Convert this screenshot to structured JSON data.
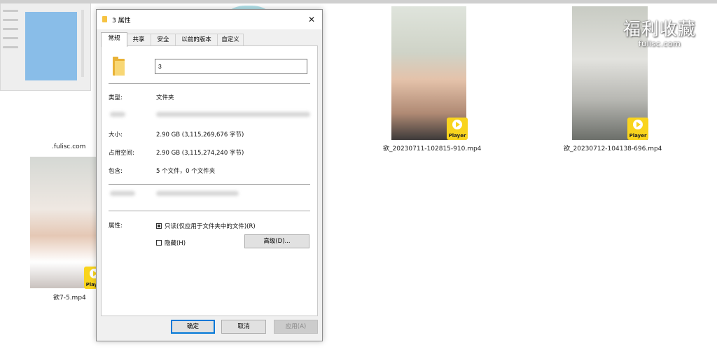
{
  "desktop": {
    "web_item_label": ".fulisc.com",
    "video_items": [
      {
        "label": "欲7-5.mp4"
      },
      {
        "label": "欲_20230711-102815-910.mp4"
      },
      {
        "label": "欲_20230712-104138-696.mp4"
      }
    ],
    "player_badge": "Player",
    "watermark": {
      "line1": "福利收藏",
      "line2": "fulisc.com"
    }
  },
  "dialog": {
    "title": "3 属性",
    "close_glyph": "✕",
    "tabs": [
      "常规",
      "共享",
      "安全",
      "以前的版本",
      "自定义"
    ],
    "active_tab": "常规",
    "name_value": "3",
    "rows": {
      "type_label": "类型:",
      "type_value": "文件夹",
      "size_label": "大小:",
      "size_value": "2.90 GB (3,115,269,676 字节)",
      "disk_label": "占用空间:",
      "disk_value": "2.90 GB (3,115,274,240 字节)",
      "contains_label": "包含:",
      "contains_value": "5 个文件，0 个文件夹",
      "attributes_label": "属性:"
    },
    "attributes": {
      "readonly_label": "只读(仅应用于文件夹中的文件)(R)",
      "readonly_state": "partial",
      "hidden_label": "隐藏(H)",
      "hidden_checked": false,
      "advanced_button": "高级(D)..."
    },
    "buttons": {
      "ok": "确定",
      "cancel": "取消",
      "apply": "应用(A)"
    }
  }
}
